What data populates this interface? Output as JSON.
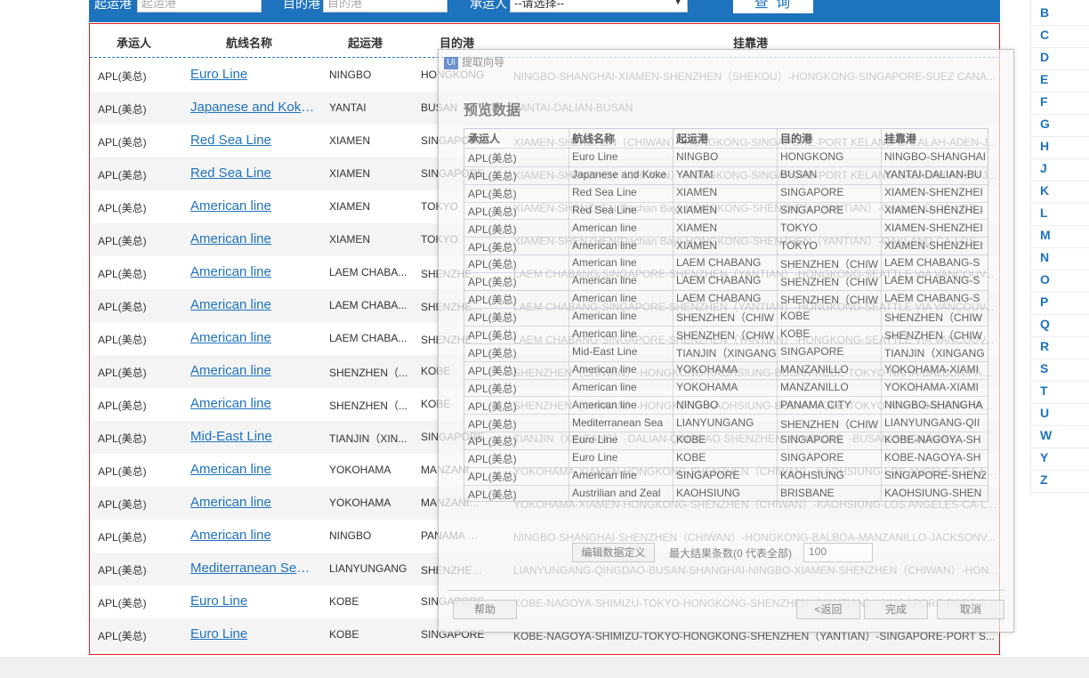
{
  "search": {
    "origin_label": "起运港",
    "origin_placeholder": "起运港",
    "dest_label": "目的港",
    "dest_placeholder": "目的港",
    "carrier_label": "承运人",
    "carrier_selected": "--请选择--",
    "query_label": "查 询"
  },
  "table": {
    "headers": {
      "carrier": "承运人",
      "line": "航线名称",
      "origin": "起运港",
      "dest": "目的港",
      "via": "挂靠港"
    },
    "rows": [
      {
        "carrier": "APL(美总)",
        "line": "Euro Line",
        "origin": "NINGBO",
        "dest": "HONGKONG",
        "via": "NINGBO-SHANGHAI-XIAMEN-SHENZHEN（SHEKOU）-HONGKONG-SINGAPORE-SUEZ CANA..."
      },
      {
        "carrier": "APL(美总)",
        "line": "Japanese and Koke...",
        "origin": "YANTAI",
        "dest": "BUSAN",
        "via": "YANTAI-DALIAN-BUSAN"
      },
      {
        "carrier": "APL(美总)",
        "line": "Red Sea Line",
        "origin": "XIAMEN",
        "dest": "SINGAPORE",
        "via": "XIAMEN-SHENZHEN（CHIWAN）-HONGKONG-SINGAPORE-PORT KELANG-SALALAH-ADEN-J..."
      },
      {
        "carrier": "APL(美总)",
        "line": "Red Sea Line",
        "origin": "XIAMEN",
        "dest": "SINGAPORE",
        "via": "XIAMEN-SHENZHEN（CHIWAN）-HONGKONG-SINGAPORE-PORT KELANG-SALALAH-ADEN-J..."
      },
      {
        "carrier": "APL(美总)",
        "line": "American line",
        "origin": "XIAMEN",
        "dest": "TOKYO",
        "via": "XIAMEN-SHENZHEN(Dachan Bay)-HONGKONG-SHENZHEN（YANTIAN）-OAKLAND-CA-LOS..."
      },
      {
        "carrier": "APL(美总)",
        "line": "American line",
        "origin": "XIAMEN",
        "dest": "TOKYO",
        "via": "XIAMEN-SHENZHEN(Dachan Bay)-HONGKONG-SHENZHEN（YANTIAN）-OAKLAND-CA-LOS..."
      },
      {
        "carrier": "APL(美总)",
        "line": "American line",
        "origin": "LAEM CHABA...",
        "dest": "SHENZHEN（...",
        "via": "LAEM CHABANG-SINGAPORE-SHENZHEN（YANTIAN）-HONGKONG-SEATTLE VIA VANCOUV..."
      },
      {
        "carrier": "APL(美总)",
        "line": "American line",
        "origin": "LAEM CHABA...",
        "dest": "SHENZHEN（...",
        "via": "LAEM CHABANG-SINGAPORE-SHENZHEN（YANTIAN）-HONGKONG-SEATTLE VIA VANCOUV..."
      },
      {
        "carrier": "APL(美总)",
        "line": "American line",
        "origin": "LAEM CHABA...",
        "dest": "SHENZHEN（...",
        "via": "LAEM CHABANG-SINGAPORE-SHENZHEN（YANTIAN）-HONGKONG-SEATTLE VIA VANCOUV..."
      },
      {
        "carrier": "APL(美总)",
        "line": "American line",
        "origin": "SHENZHEN（...",
        "dest": "KOBE",
        "via": "SHENZHEN（CHIWAN）-HONGKONG-KAOHSIUNG-BUSAN-KOBE-TOKYO-NAHA-BALBOA-PAN..."
      },
      {
        "carrier": "APL(美总)",
        "line": "American line",
        "origin": "SHENZHEN（...",
        "dest": "KOBE",
        "via": "SHENZHEN（CHIWAN）-HONGKONG-KAOHSIUNG-BUSAN-KOBE-TOKYO-NAHA-BALBOA-PAN..."
      },
      {
        "carrier": "APL(美总)",
        "line": "Mid-East Line",
        "origin": "TIANJIN（XIN...",
        "dest": "SINGAPORE",
        "via": "TIANJIN（XINGANG）-DALIAN-QINGDAO-SHENZHEN（SHEKOU）-BUSAN-SINGAPORE"
      },
      {
        "carrier": "APL(美总)",
        "line": "American line",
        "origin": "YOKOHAMA",
        "dest": "MANZANILLO",
        "via": "YOKOHAMA-XIAMEN-HONGKONG-SHENZHEN（CHIWAN）-KAOHSIUNG-LOS ANGELES-CA-LO..."
      },
      {
        "carrier": "APL(美总)",
        "line": "American line",
        "origin": "YOKOHAMA",
        "dest": "MANZANILLO",
        "via": "YOKOHAMA-XIAMEN-HONGKONG-SHENZHEN（CHIWAN）-KAOHSIUNG-LOS ANGELES-CA-LO..."
      },
      {
        "carrier": "APL(美总)",
        "line": "American line",
        "origin": "NINGBO",
        "dest": "PANAMA CITY",
        "via": "NINGBO-SHANGHAI-SHENZHEN（CHIWAN）-HONGKONG-BALBOA-MANZANILLO-JACKSONV..."
      },
      {
        "carrier": "APL(美总)",
        "line": "Mediterranean Sea ...",
        "origin": "LIANYUNGANG",
        "dest": "SHENZHEN（...",
        "via": "LIANYUNGANG-QINGDAO-BUSAN-SHANGHAI-NINGBO-XIAMEN-SHENZHEN（CHIWAN）-HON..."
      },
      {
        "carrier": "APL(美总)",
        "line": "Euro Line",
        "origin": "KOBE",
        "dest": "SINGAPORE",
        "via": "KOBE-NAGOYA-SHIMIZU-TOKYO-HONGKONG-SHENZHEN（YANTIAN）-SINGAPORE-PORT S..."
      },
      {
        "carrier": "APL(美总)",
        "line": "Euro Line",
        "origin": "KOBE",
        "dest": "SINGAPORE",
        "via": "KOBE-NAGOYA-SHIMIZU-TOKYO-HONGKONG-SHENZHEN（YANTIAN）-SINGAPORE-PORT S..."
      }
    ]
  },
  "alphabet": [
    "B",
    "C",
    "D",
    "E",
    "F",
    "G",
    "H",
    "J",
    "K",
    "L",
    "M",
    "N",
    "O",
    "P",
    "Q",
    "R",
    "S",
    "T",
    "U",
    "W",
    "Y",
    "Z"
  ],
  "wizard": {
    "title": "提取向导",
    "logo": "Ui",
    "section": "预览数据",
    "headers": [
      "承运人",
      "航线名称",
      "起运港",
      "目的港",
      "挂靠港"
    ],
    "rows": [
      [
        "APL(美总)",
        "Euro Line",
        "NINGBO",
        "HONGKONG",
        "NINGBO-SHANGHAI"
      ],
      [
        "APL(美总)",
        "Japanese and Koke",
        "YANTAI",
        "BUSAN",
        "YANTAI-DALIAN-BU"
      ],
      [
        "APL(美总)",
        "Red Sea Line",
        "XIAMEN",
        "SINGAPORE",
        "XIAMEN-SHENZHEI"
      ],
      [
        "APL(美总)",
        "Red Sea Line",
        "XIAMEN",
        "SINGAPORE",
        "XIAMEN-SHENZHEI"
      ],
      [
        "APL(美总)",
        "American line",
        "XIAMEN",
        "TOKYO",
        "XIAMEN-SHENZHEI"
      ],
      [
        "APL(美总)",
        "American line",
        "XIAMEN",
        "TOKYO",
        "XIAMEN-SHENZHEI"
      ],
      [
        "APL(美总)",
        "American line",
        "LAEM CHABANG",
        "SHENZHEN（CHIW",
        "LAEM CHABANG-S"
      ],
      [
        "APL(美总)",
        "American line",
        "LAEM CHABANG",
        "SHENZHEN（CHIW",
        "LAEM CHABANG-S"
      ],
      [
        "APL(美总)",
        "American line",
        "LAEM CHABANG",
        "SHENZHEN（CHIW",
        "LAEM CHABANG-S"
      ],
      [
        "APL(美总)",
        "American line",
        "SHENZHEN（CHIW",
        "KOBE",
        "SHENZHEN（CHIW"
      ],
      [
        "APL(美总)",
        "American line",
        "SHENZHEN（CHIW",
        "KOBE",
        "SHENZHEN（CHIW"
      ],
      [
        "APL(美总)",
        "Mid-East Line",
        "TIANJIN（XINGANG",
        "SINGAPORE",
        "TIANJIN（XINGANG"
      ],
      [
        "APL(美总)",
        "American line",
        "YOKOHAMA",
        "MANZANILLO",
        "YOKOHAMA-XIAMI"
      ],
      [
        "APL(美总)",
        "American line",
        "YOKOHAMA",
        "MANZANILLO",
        "YOKOHAMA-XIAMI"
      ],
      [
        "APL(美总)",
        "American line",
        "NINGBO",
        "PANAMA CITY",
        "NINGBO-SHANGHA"
      ],
      [
        "APL(美总)",
        "Mediterranean Sea",
        "LIANYUNGANG",
        "SHENZHEN（CHIW",
        "LIANYUNGANG-QII"
      ],
      [
        "APL(美总)",
        "Euro Line",
        "KOBE",
        "SINGAPORE",
        "KOBE-NAGOYA-SH"
      ],
      [
        "APL(美总)",
        "Euro Line",
        "KOBE",
        "SINGAPORE",
        "KOBE-NAGOYA-SH"
      ],
      [
        "APL(美总)",
        "American line",
        "SINGAPORE",
        "KAOHSIUNG",
        "SINGAPORE-SHENZ"
      ],
      [
        "APL(美总)",
        "Austrilian and Zeal",
        "KAOHSIUNG",
        "BRISBANE",
        "KAOHSIUNG-SHEN"
      ]
    ],
    "edit_label": "编辑数据定义",
    "max_label": "最大结果条数(0 代表全部)",
    "max_value": "100",
    "help_label": "帮助",
    "back_label": "<返回",
    "finish_label": "完成",
    "cancel_label": "取消"
  }
}
